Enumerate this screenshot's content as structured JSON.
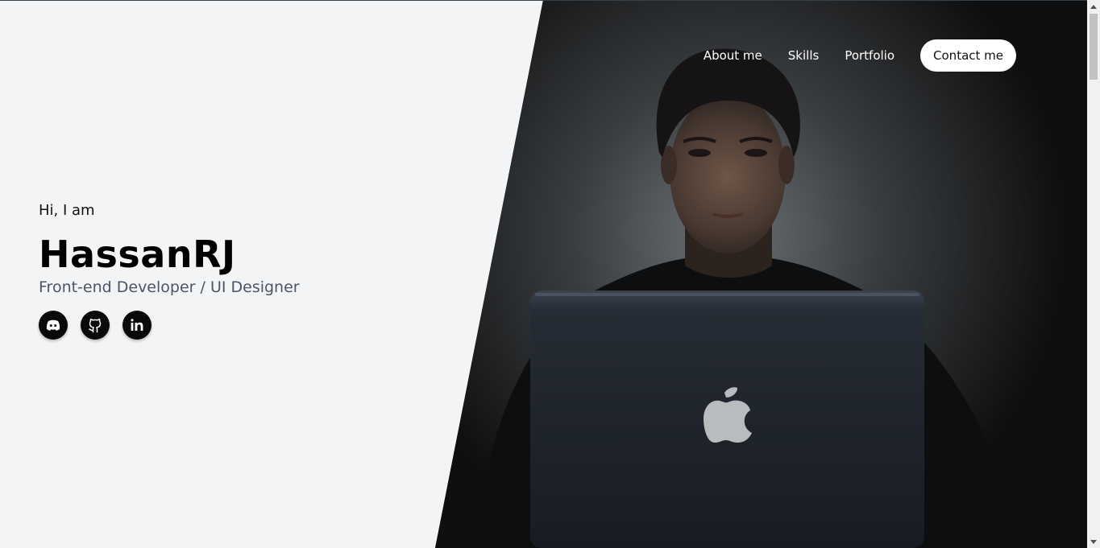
{
  "nav": {
    "items": [
      {
        "label": "About me"
      },
      {
        "label": "Skills"
      },
      {
        "label": "Portfolio"
      }
    ],
    "contact_label": "Contact me"
  },
  "hero": {
    "greeting": "Hi, I am",
    "name": "HassanRJ",
    "role": "Front-end Developer / UI Designer",
    "socials": [
      {
        "icon": "discord-icon"
      },
      {
        "icon": "github-icon"
      },
      {
        "icon": "linkedin-icon"
      }
    ],
    "photo": "person-with-laptop-in-dark"
  },
  "colors": {
    "background": "#f3f4f6",
    "accent": "#0a0a0a",
    "nav_text": "#ffffff",
    "role_text": "#4b5563"
  }
}
